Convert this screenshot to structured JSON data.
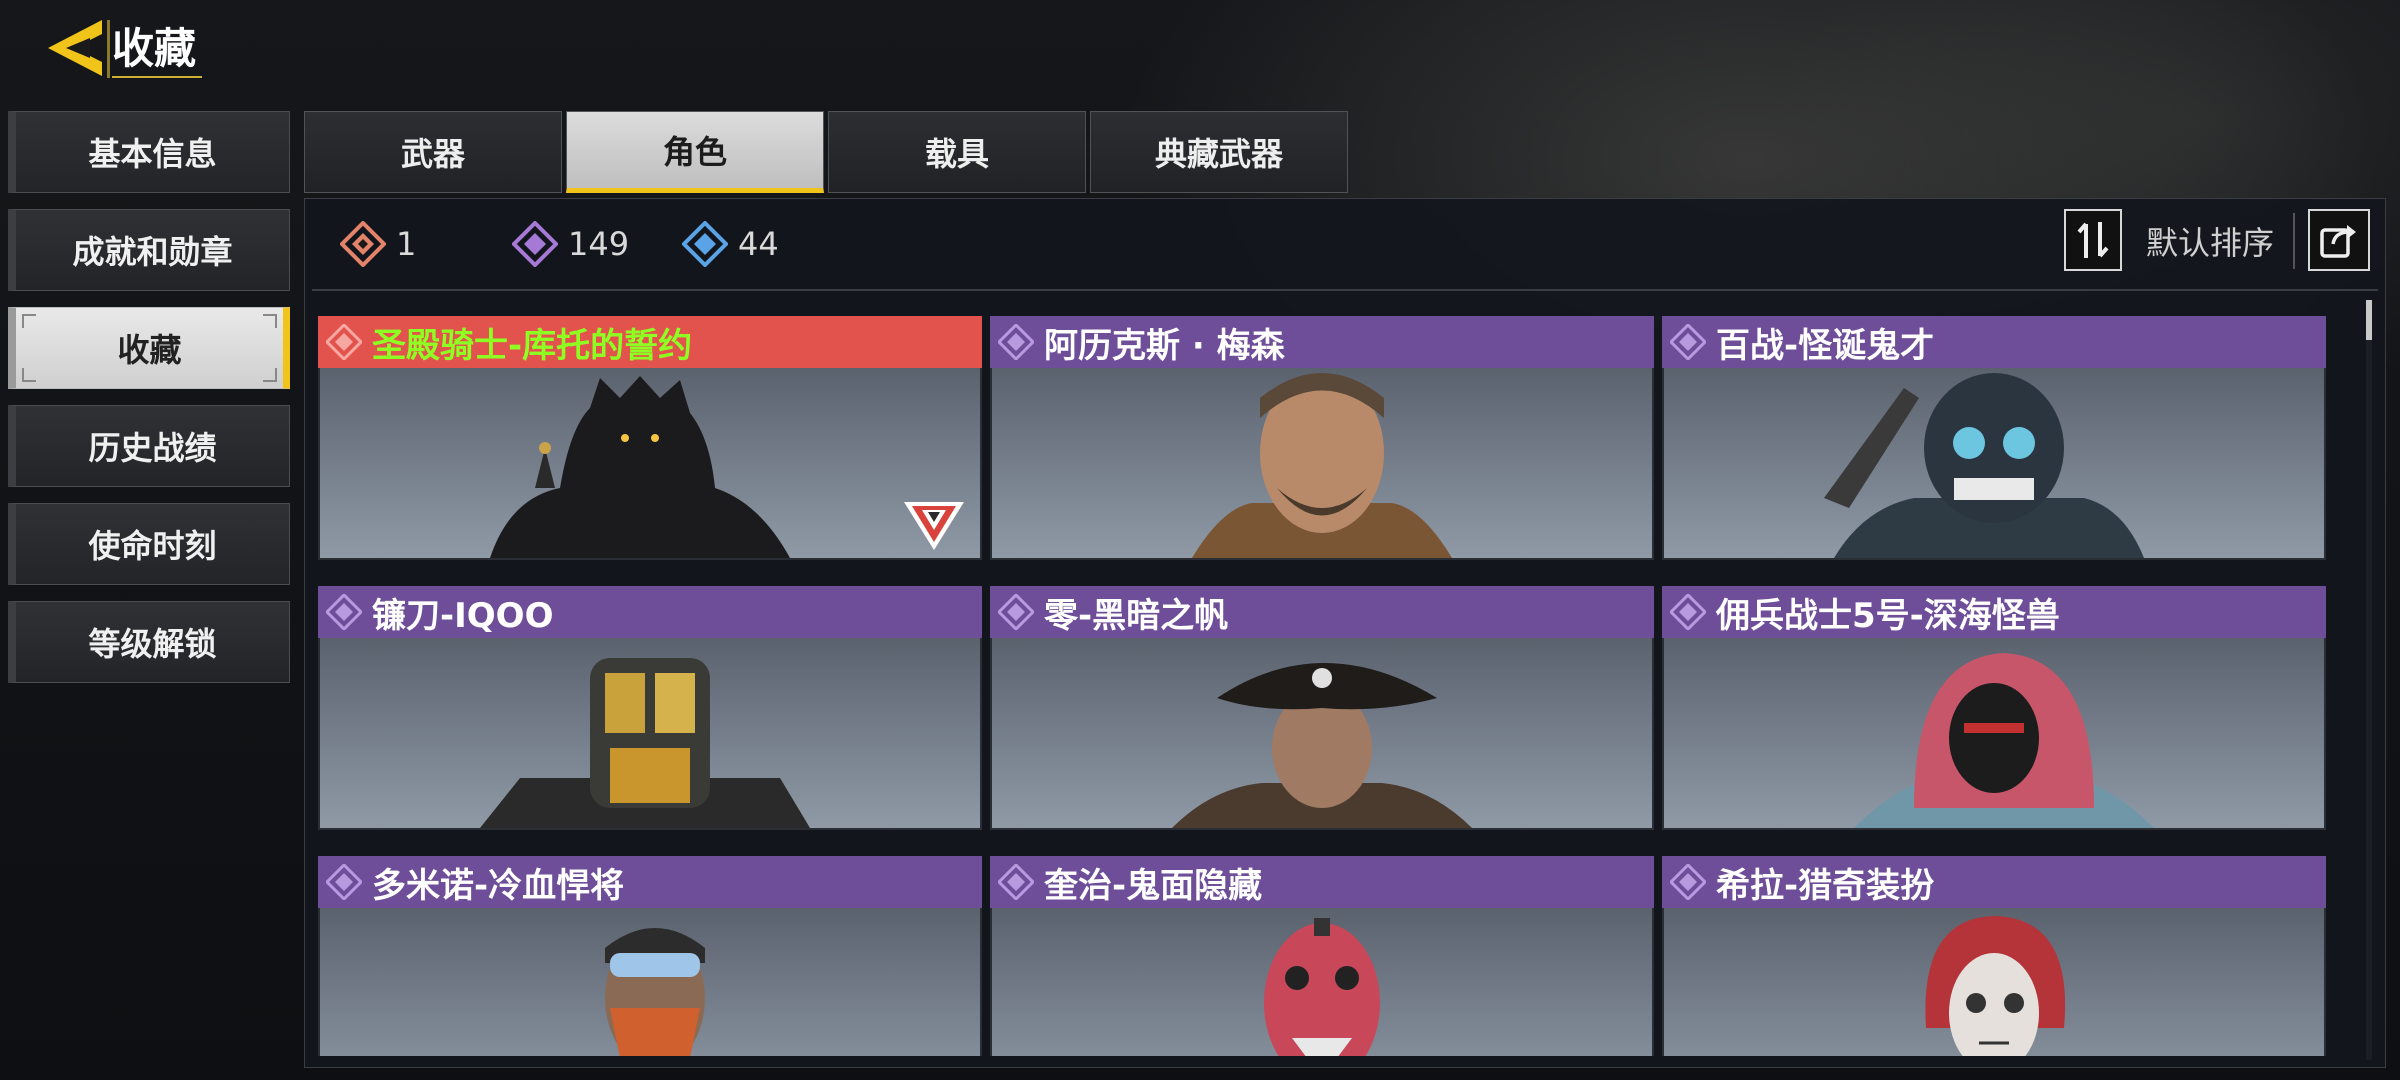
{
  "header": {
    "title": "收藏"
  },
  "sidebar": {
    "items": [
      {
        "label": "基本信息",
        "active": false
      },
      {
        "label": "成就和勋章",
        "active": false
      },
      {
        "label": "收藏",
        "active": true
      },
      {
        "label": "历史战绩",
        "active": false
      },
      {
        "label": "使命时刻",
        "active": false
      },
      {
        "label": "等级解锁",
        "active": false
      }
    ]
  },
  "tabs": [
    {
      "label": "武器",
      "active": false
    },
    {
      "label": "角色",
      "active": true
    },
    {
      "label": "载具",
      "active": false
    },
    {
      "label": "典藏武器",
      "active": false
    }
  ],
  "currency": [
    {
      "icon": "legendary-gem-icon",
      "value": "1",
      "color": "#e2836a"
    },
    {
      "icon": "epic-gem-icon",
      "value": "149",
      "color": "#a779d6"
    },
    {
      "icon": "rare-gem-icon",
      "value": "44",
      "color": "#5aa3e6"
    }
  ],
  "sort": {
    "label": "默认排序"
  },
  "colors": {
    "accent": "#f0c419",
    "legendary": "#e2534d",
    "legendary_text": "#8eff22",
    "epic": "#6e4e98"
  },
  "cards": [
    {
      "name": "圣殿骑士-库托的誓约",
      "rarity": "legendary",
      "portrait": "dark-knight-portrait"
    },
    {
      "name": "阿历克斯 · 梅森",
      "rarity": "epic",
      "portrait": "soldier-portrait"
    },
    {
      "name": "百战-怪诞鬼才",
      "rarity": "epic",
      "portrait": "masked-soldier-portrait"
    },
    {
      "name": "镰刀-IQOO",
      "rarity": "epic",
      "portrait": "robot-portrait"
    },
    {
      "name": "零-黑暗之帆",
      "rarity": "epic",
      "portrait": "pirate-portrait"
    },
    {
      "name": "佣兵战士5号-深海怪兽",
      "rarity": "epic",
      "portrait": "hooded-portrait"
    },
    {
      "name": "多米诺-冷血悍将",
      "rarity": "epic",
      "portrait": "goggles-portrait"
    },
    {
      "name": "奎治-鬼面隐藏",
      "rarity": "epic",
      "portrait": "demon-mask-portrait"
    },
    {
      "name": "希拉-猎奇装扮",
      "rarity": "epic",
      "portrait": "skull-face-portrait"
    }
  ]
}
